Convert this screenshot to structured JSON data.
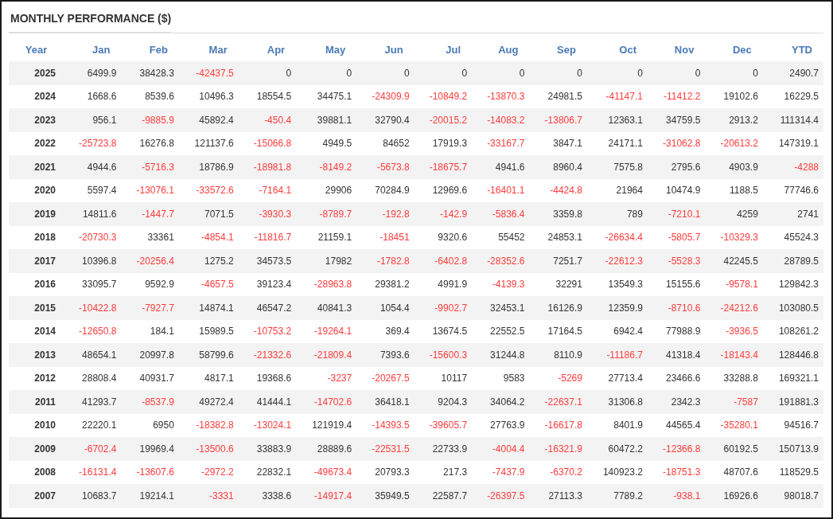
{
  "title": "MONTHLY PERFORMANCE ($)",
  "table": {
    "columns": [
      "Year",
      "Jan",
      "Feb",
      "Mar",
      "Apr",
      "May",
      "Jun",
      "Jul",
      "Aug",
      "Sep",
      "Oct",
      "Nov",
      "Dec",
      "YTD"
    ],
    "rows": [
      {
        "cells": [
          {
            "value": "2025",
            "negative": false
          },
          {
            "value": "6499.9",
            "negative": false
          },
          {
            "value": "38428.3",
            "negative": false
          },
          {
            "value": "-42437.5",
            "negative": true
          },
          {
            "value": "0",
            "negative": false
          },
          {
            "value": "0",
            "negative": false
          },
          {
            "value": "0",
            "negative": false
          },
          {
            "value": "0",
            "negative": false
          },
          {
            "value": "0",
            "negative": false
          },
          {
            "value": "0",
            "negative": false
          },
          {
            "value": "0",
            "negative": false
          },
          {
            "value": "0",
            "negative": false
          },
          {
            "value": "0",
            "negative": false
          },
          {
            "value": "2490.7",
            "negative": false
          }
        ]
      },
      {
        "cells": [
          {
            "value": "2024",
            "negative": false
          },
          {
            "value": "1668.6",
            "negative": false
          },
          {
            "value": "8539.6",
            "negative": false
          },
          {
            "value": "10496.3",
            "negative": false
          },
          {
            "value": "18554.5",
            "negative": false
          },
          {
            "value": "34475.1",
            "negative": false
          },
          {
            "value": "-24309.9",
            "negative": true
          },
          {
            "value": "-10849.2",
            "negative": true
          },
          {
            "value": "-13870.3",
            "negative": true
          },
          {
            "value": "24981.5",
            "negative": false
          },
          {
            "value": "-41147.1",
            "negative": true
          },
          {
            "value": "-11412.2",
            "negative": true
          },
          {
            "value": "19102.6",
            "negative": false
          },
          {
            "value": "16229.5",
            "negative": false
          }
        ]
      },
      {
        "cells": [
          {
            "value": "2023",
            "negative": false
          },
          {
            "value": "956.1",
            "negative": false
          },
          {
            "value": "-9885.9",
            "negative": true
          },
          {
            "value": "45892.4",
            "negative": false
          },
          {
            "value": "-450.4",
            "negative": true
          },
          {
            "value": "39881.1",
            "negative": false
          },
          {
            "value": "32790.4",
            "negative": false
          },
          {
            "value": "-20015.2",
            "negative": true
          },
          {
            "value": "-14083.2",
            "negative": true
          },
          {
            "value": "-13806.7",
            "negative": true
          },
          {
            "value": "12363.1",
            "negative": false
          },
          {
            "value": "34759.5",
            "negative": false
          },
          {
            "value": "2913.2",
            "negative": false
          },
          {
            "value": "111314.4",
            "negative": false
          }
        ]
      },
      {
        "cells": [
          {
            "value": "2022",
            "negative": false
          },
          {
            "value": "-25723.8",
            "negative": true
          },
          {
            "value": "16276.8",
            "negative": false
          },
          {
            "value": "121137.6",
            "negative": false
          },
          {
            "value": "-15066.8",
            "negative": true
          },
          {
            "value": "4949.5",
            "negative": false
          },
          {
            "value": "84652",
            "negative": false
          },
          {
            "value": "17919.3",
            "negative": false
          },
          {
            "value": "-33167.7",
            "negative": true
          },
          {
            "value": "3847.1",
            "negative": false
          },
          {
            "value": "24171.1",
            "negative": false
          },
          {
            "value": "-31062.8",
            "negative": true
          },
          {
            "value": "-20613.2",
            "negative": true
          },
          {
            "value": "147319.1",
            "negative": false
          }
        ]
      },
      {
        "cells": [
          {
            "value": "2021",
            "negative": false
          },
          {
            "value": "4944.6",
            "negative": false
          },
          {
            "value": "-5716.3",
            "negative": true
          },
          {
            "value": "18786.9",
            "negative": false
          },
          {
            "value": "-18981.8",
            "negative": true
          },
          {
            "value": "-8149.2",
            "negative": true
          },
          {
            "value": "-5673.8",
            "negative": true
          },
          {
            "value": "-18675.7",
            "negative": true
          },
          {
            "value": "4941.6",
            "negative": false
          },
          {
            "value": "8960.4",
            "negative": false
          },
          {
            "value": "7575.8",
            "negative": false
          },
          {
            "value": "2795.6",
            "negative": false
          },
          {
            "value": "4903.9",
            "negative": false
          },
          {
            "value": "-4288",
            "negative": true
          }
        ]
      },
      {
        "cells": [
          {
            "value": "2020",
            "negative": false
          },
          {
            "value": "5597.4",
            "negative": false
          },
          {
            "value": "-13076.1",
            "negative": true
          },
          {
            "value": "-33572.6",
            "negative": true
          },
          {
            "value": "-7164.1",
            "negative": true
          },
          {
            "value": "29906",
            "negative": false
          },
          {
            "value": "70284.9",
            "negative": false
          },
          {
            "value": "12969.6",
            "negative": false
          },
          {
            "value": "-16401.1",
            "negative": true
          },
          {
            "value": "-4424.8",
            "negative": true
          },
          {
            "value": "21964",
            "negative": false
          },
          {
            "value": "10474.9",
            "negative": false
          },
          {
            "value": "1188.5",
            "negative": false
          },
          {
            "value": "77746.6",
            "negative": false
          }
        ]
      },
      {
        "cells": [
          {
            "value": "2019",
            "negative": false
          },
          {
            "value": "14811.6",
            "negative": false
          },
          {
            "value": "-1447.7",
            "negative": true
          },
          {
            "value": "7071.5",
            "negative": false
          },
          {
            "value": "-3930.3",
            "negative": true
          },
          {
            "value": "-8789.7",
            "negative": true
          },
          {
            "value": "-192.8",
            "negative": true
          },
          {
            "value": "-142.9",
            "negative": true
          },
          {
            "value": "-5836.4",
            "negative": true
          },
          {
            "value": "3359.8",
            "negative": false
          },
          {
            "value": "789",
            "negative": false
          },
          {
            "value": "-7210.1",
            "negative": true
          },
          {
            "value": "4259",
            "negative": false
          },
          {
            "value": "2741",
            "negative": false
          }
        ]
      },
      {
        "cells": [
          {
            "value": "2018",
            "negative": false
          },
          {
            "value": "-20730.3",
            "negative": true
          },
          {
            "value": "33361",
            "negative": false
          },
          {
            "value": "-4854.1",
            "negative": true
          },
          {
            "value": "-11816.7",
            "negative": true
          },
          {
            "value": "21159.1",
            "negative": false
          },
          {
            "value": "-18451",
            "negative": true
          },
          {
            "value": "9320.6",
            "negative": false
          },
          {
            "value": "55452",
            "negative": false
          },
          {
            "value": "24853.1",
            "negative": false
          },
          {
            "value": "-26634.4",
            "negative": true
          },
          {
            "value": "-5805.7",
            "negative": true
          },
          {
            "value": "-10329.3",
            "negative": true
          },
          {
            "value": "45524.3",
            "negative": false
          }
        ]
      },
      {
        "cells": [
          {
            "value": "2017",
            "negative": false
          },
          {
            "value": "10396.8",
            "negative": false
          },
          {
            "value": "-20256.4",
            "negative": true
          },
          {
            "value": "1275.2",
            "negative": false
          },
          {
            "value": "34573.5",
            "negative": false
          },
          {
            "value": "17982",
            "negative": false
          },
          {
            "value": "-1782.8",
            "negative": true
          },
          {
            "value": "-6402.8",
            "negative": true
          },
          {
            "value": "-28352.6",
            "negative": true
          },
          {
            "value": "7251.7",
            "negative": false
          },
          {
            "value": "-22612.3",
            "negative": true
          },
          {
            "value": "-5528.3",
            "negative": true
          },
          {
            "value": "42245.5",
            "negative": false
          },
          {
            "value": "28789.5",
            "negative": false
          }
        ]
      },
      {
        "cells": [
          {
            "value": "2016",
            "negative": false
          },
          {
            "value": "33095.7",
            "negative": false
          },
          {
            "value": "9592.9",
            "negative": false
          },
          {
            "value": "-4657.5",
            "negative": true
          },
          {
            "value": "39123.4",
            "negative": false
          },
          {
            "value": "-28963.8",
            "negative": true
          },
          {
            "value": "29381.2",
            "negative": false
          },
          {
            "value": "4991.9",
            "negative": false
          },
          {
            "value": "-4139.3",
            "negative": true
          },
          {
            "value": "32291",
            "negative": false
          },
          {
            "value": "13549.3",
            "negative": false
          },
          {
            "value": "15155.6",
            "negative": false
          },
          {
            "value": "-9578.1",
            "negative": true
          },
          {
            "value": "129842.3",
            "negative": false
          }
        ]
      },
      {
        "cells": [
          {
            "value": "2015",
            "negative": false
          },
          {
            "value": "-10422.8",
            "negative": true
          },
          {
            "value": "-7927.7",
            "negative": true
          },
          {
            "value": "14874.1",
            "negative": false
          },
          {
            "value": "46547.2",
            "negative": false
          },
          {
            "value": "40841.3",
            "negative": false
          },
          {
            "value": "1054.4",
            "negative": false
          },
          {
            "value": "-9902.7",
            "negative": true
          },
          {
            "value": "32453.1",
            "negative": false
          },
          {
            "value": "16126.9",
            "negative": false
          },
          {
            "value": "12359.9",
            "negative": false
          },
          {
            "value": "-8710.6",
            "negative": true
          },
          {
            "value": "-24212.6",
            "negative": true
          },
          {
            "value": "103080.5",
            "negative": false
          }
        ]
      },
      {
        "cells": [
          {
            "value": "2014",
            "negative": false
          },
          {
            "value": "-12650.8",
            "negative": true
          },
          {
            "value": "184.1",
            "negative": false
          },
          {
            "value": "15989.5",
            "negative": false
          },
          {
            "value": "-10753.2",
            "negative": true
          },
          {
            "value": "-19264.1",
            "negative": true
          },
          {
            "value": "369.4",
            "negative": false
          },
          {
            "value": "13674.5",
            "negative": false
          },
          {
            "value": "22552.5",
            "negative": false
          },
          {
            "value": "17164.5",
            "negative": false
          },
          {
            "value": "6942.4",
            "negative": false
          },
          {
            "value": "77988.9",
            "negative": false
          },
          {
            "value": "-3936.5",
            "negative": true
          },
          {
            "value": "108261.2",
            "negative": false
          }
        ]
      },
      {
        "cells": [
          {
            "value": "2013",
            "negative": false
          },
          {
            "value": "48654.1",
            "negative": false
          },
          {
            "value": "20997.8",
            "negative": false
          },
          {
            "value": "58799.6",
            "negative": false
          },
          {
            "value": "-21332.6",
            "negative": true
          },
          {
            "value": "-21809.4",
            "negative": true
          },
          {
            "value": "7393.6",
            "negative": false
          },
          {
            "value": "-15600.3",
            "negative": true
          },
          {
            "value": "31244.8",
            "negative": false
          },
          {
            "value": "8110.9",
            "negative": false
          },
          {
            "value": "-11186.7",
            "negative": true
          },
          {
            "value": "41318.4",
            "negative": false
          },
          {
            "value": "-18143.4",
            "negative": true
          },
          {
            "value": "128446.8",
            "negative": false
          }
        ]
      },
      {
        "cells": [
          {
            "value": "2012",
            "negative": false
          },
          {
            "value": "28808.4",
            "negative": false
          },
          {
            "value": "40931.7",
            "negative": false
          },
          {
            "value": "4817.1",
            "negative": false
          },
          {
            "value": "19368.6",
            "negative": false
          },
          {
            "value": "-3237",
            "negative": true
          },
          {
            "value": "-20267.5",
            "negative": true
          },
          {
            "value": "10117",
            "negative": false
          },
          {
            "value": "9583",
            "negative": false
          },
          {
            "value": "-5269",
            "negative": true
          },
          {
            "value": "27713.4",
            "negative": false
          },
          {
            "value": "23466.6",
            "negative": false
          },
          {
            "value": "33288.8",
            "negative": false
          },
          {
            "value": "169321.1",
            "negative": false
          }
        ]
      },
      {
        "cells": [
          {
            "value": "2011",
            "negative": false
          },
          {
            "value": "41293.7",
            "negative": false
          },
          {
            "value": "-8537.9",
            "negative": true
          },
          {
            "value": "49272.4",
            "negative": false
          },
          {
            "value": "41444.1",
            "negative": false
          },
          {
            "value": "-14702.6",
            "negative": true
          },
          {
            "value": "36418.1",
            "negative": false
          },
          {
            "value": "9204.3",
            "negative": false
          },
          {
            "value": "34064.2",
            "negative": false
          },
          {
            "value": "-22637.1",
            "negative": true
          },
          {
            "value": "31306.8",
            "negative": false
          },
          {
            "value": "2342.3",
            "negative": false
          },
          {
            "value": "-7587",
            "negative": true
          },
          {
            "value": "191881.3",
            "negative": false
          }
        ]
      },
      {
        "cells": [
          {
            "value": "2010",
            "negative": false
          },
          {
            "value": "22220.1",
            "negative": false
          },
          {
            "value": "6950",
            "negative": false
          },
          {
            "value": "-18382.8",
            "negative": true
          },
          {
            "value": "-13024.1",
            "negative": true
          },
          {
            "value": "121919.4",
            "negative": false
          },
          {
            "value": "-14393.5",
            "negative": true
          },
          {
            "value": "-39605.7",
            "negative": true
          },
          {
            "value": "27763.9",
            "negative": false
          },
          {
            "value": "-16617.8",
            "negative": true
          },
          {
            "value": "8401.9",
            "negative": false
          },
          {
            "value": "44565.4",
            "negative": false
          },
          {
            "value": "-35280.1",
            "negative": true
          },
          {
            "value": "94516.7",
            "negative": false
          }
        ]
      },
      {
        "cells": [
          {
            "value": "2009",
            "negative": false
          },
          {
            "value": "-6702.4",
            "negative": true
          },
          {
            "value": "19969.4",
            "negative": false
          },
          {
            "value": "-13500.6",
            "negative": true
          },
          {
            "value": "33883.9",
            "negative": false
          },
          {
            "value": "28889.6",
            "negative": false
          },
          {
            "value": "-22531.5",
            "negative": true
          },
          {
            "value": "22733.9",
            "negative": false
          },
          {
            "value": "-4004.4",
            "negative": true
          },
          {
            "value": "-16321.9",
            "negative": true
          },
          {
            "value": "60472.2",
            "negative": false
          },
          {
            "value": "-12366.8",
            "negative": true
          },
          {
            "value": "60192.5",
            "negative": false
          },
          {
            "value": "150713.9",
            "negative": false
          }
        ]
      },
      {
        "cells": [
          {
            "value": "2008",
            "negative": false
          },
          {
            "value": "-16131.4",
            "negative": true
          },
          {
            "value": "-13607.6",
            "negative": true
          },
          {
            "value": "-2972.2",
            "negative": true
          },
          {
            "value": "22832.1",
            "negative": false
          },
          {
            "value": "-49673.4",
            "negative": true
          },
          {
            "value": "20793.3",
            "negative": false
          },
          {
            "value": "217.3",
            "negative": false
          },
          {
            "value": "-7437.9",
            "negative": true
          },
          {
            "value": "-6370.2",
            "negative": true
          },
          {
            "value": "140923.2",
            "negative": false
          },
          {
            "value": "-18751.3",
            "negative": true
          },
          {
            "value": "48707.6",
            "negative": false
          },
          {
            "value": "118529.5",
            "negative": false
          }
        ]
      },
      {
        "cells": [
          {
            "value": "2007",
            "negative": false
          },
          {
            "value": "10683.7",
            "negative": false
          },
          {
            "value": "19214.1",
            "negative": false
          },
          {
            "value": "-3331",
            "negative": true
          },
          {
            "value": "3338.6",
            "negative": false
          },
          {
            "value": "-14917.4",
            "negative": true
          },
          {
            "value": "35949.5",
            "negative": false
          },
          {
            "value": "22587.7",
            "negative": false
          },
          {
            "value": "-26397.5",
            "negative": true
          },
          {
            "value": "27113.3",
            "negative": false
          },
          {
            "value": "7789.2",
            "negative": false
          },
          {
            "value": "-938.1",
            "negative": true
          },
          {
            "value": "16926.6",
            "negative": false
          },
          {
            "value": "98018.7",
            "negative": false
          }
        ]
      }
    ]
  }
}
